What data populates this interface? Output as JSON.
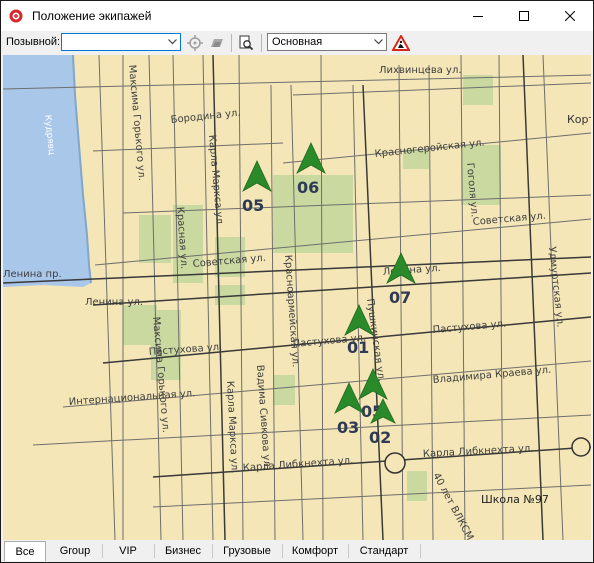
{
  "window": {
    "title": "Положение экипажей",
    "minimize_icon": "minimize-icon",
    "maximize_icon": "maximize-icon",
    "close_icon": "close-icon"
  },
  "toolbar": {
    "callsign_label": "Позывной:",
    "callsign_value": "",
    "map_layer_value": "Основная",
    "icons": [
      "locate-crosshair-icon",
      "layers-icon",
      "search-document-icon",
      "road-works-warning-icon"
    ]
  },
  "map": {
    "vehicles": [
      {
        "id": "05",
        "color": "#2e8b2e"
      },
      {
        "id": "06",
        "color": "#2e8b2e"
      },
      {
        "id": "07",
        "color": "#2e8b2e"
      },
      {
        "id": "01",
        "color": "#2e8b2e"
      },
      {
        "id": "05",
        "color": "#2e8b2e"
      },
      {
        "id": "03",
        "color": "#2e8b2e"
      },
      {
        "id": "02",
        "color": "#2e8b2e"
      }
    ],
    "street_labels": {
      "lihvintseva": "Лихвинцева ул.",
      "krasnogeroyskaya": "Красногеройская ул.",
      "sovetskaya_e": "Советская ул.",
      "sovetskaya_w": "Советская ул.",
      "lenina_e": "Ленина ул.",
      "lenina_w": "Ленина ул.",
      "pastukhova_e": "Пастухова ул.",
      "pastukhova_m": "Пастухова ул.",
      "pastukhova_w": "Пастухова ул.",
      "krayeva": "Владимира Краева ул.",
      "karla_libknekhta_e": "Карла Либкнехта ул.",
      "karla_libknekhta_w": "Карла Либкнехта ул.",
      "internatsionalnaya": "Интернациональная ул.",
      "borodina": "Бородина ул.",
      "gorkogo_n": "Максима Горького ул.",
      "gorkogo_s": "Максима Горького ул.",
      "karla_marksa_n": "Карла Маркса ул.",
      "karla_marksa_s": "Карла Маркса ул.",
      "krasnaya": "Красная ул.",
      "krasnoarmeyskaya": "Красноармейская ул.",
      "pushkinskaya": "Пушкинская ул.",
      "sivkova": "Вадима Сивкова ул.",
      "udmurtskaya": "Удмуртская ул.",
      "gogolya": "Гоголя ул.",
      "lenina_short": "Ленина пр.",
      "vlksm": "40 лет ВЛКСМ ул.",
      "kort": "Корт",
      "school": "Школа №97",
      "lake": "Кудрявц"
    }
  },
  "tabs": [
    {
      "label": "Все",
      "active": true
    },
    {
      "label": "Group",
      "active": false
    },
    {
      "label": "VIP",
      "active": false
    },
    {
      "label": "Бизнес",
      "active": false
    },
    {
      "label": "Грузовые",
      "active": false
    },
    {
      "label": "Комфорт",
      "active": false
    },
    {
      "label": "Стандарт",
      "active": false
    }
  ]
}
